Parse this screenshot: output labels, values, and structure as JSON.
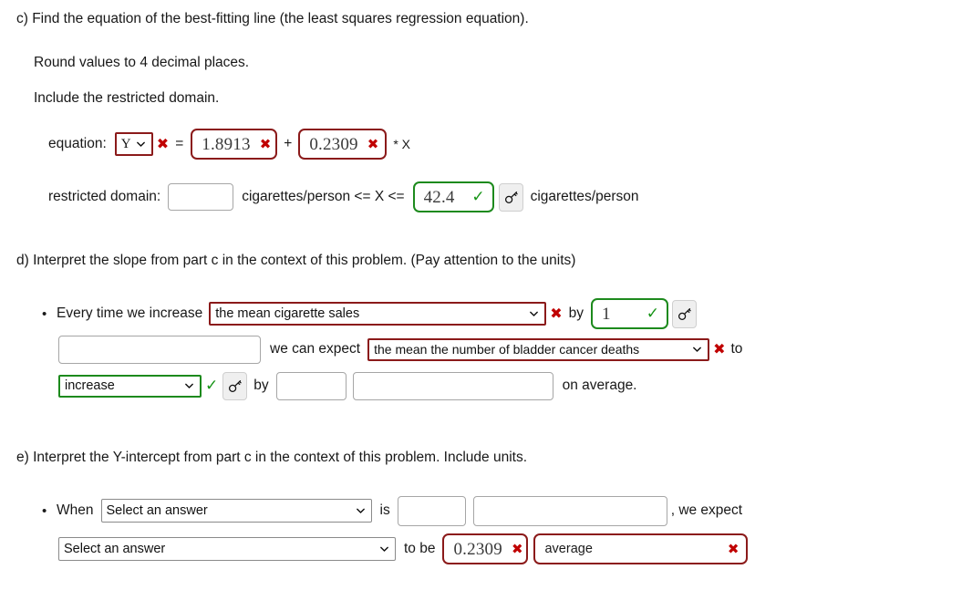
{
  "colors": {
    "incorrect": "#8b1a1a",
    "correct": "#1d8a1d",
    "x_mark": "#c00000",
    "check_mark": "#169416",
    "neutral_border": "#a6a6a6",
    "text": "#181818"
  },
  "part_c": {
    "prompt": "c) Find the equation of the best-fitting line (the least squares regression equation).",
    "instruction_round": "Round values to 4 decimal places.",
    "instruction_domain": "Include the restricted domain.",
    "equation": {
      "label": "equation:",
      "variable_select": {
        "value": "Y",
        "status": "incorrect"
      },
      "variable_status_icon": "x-mark",
      "equals": "=",
      "intercept": {
        "value": "1.8913",
        "status": "incorrect",
        "status_icon": "x-mark"
      },
      "plus": "+",
      "slope": {
        "value": "0.2309",
        "status": "incorrect",
        "status_icon": "x-mark"
      },
      "times_x": "* X"
    },
    "restricted_domain": {
      "label": "restricted domain:",
      "min_value": "",
      "min_placeholder": "",
      "middle_text": "cigarettes/person <= X <=",
      "max_value": "42.4",
      "max_status": "correct",
      "max_status_icon": "check-mark",
      "key_button": "key-icon",
      "units": "cigarettes/person"
    }
  },
  "part_d": {
    "prompt": "d) Interpret the slope from part c in the context of this problem. (Pay attention to the units)",
    "line1": {
      "lead": "Every time we increase",
      "subject_select": {
        "value": "the mean cigarette sales",
        "status": "incorrect"
      },
      "subject_status_icon": "x-mark",
      "by": "by",
      "amount": {
        "value": "1",
        "status": "correct",
        "status_icon": "check-mark"
      },
      "key_button": "key-icon"
    },
    "line2": {
      "units_input": "",
      "mid": "we can expect",
      "object_select": {
        "value": "the mean the number of bladder cancer deaths",
        "status": "incorrect"
      },
      "object_status_icon": "x-mark",
      "to": "to"
    },
    "line3": {
      "direction_select": {
        "value": "increase",
        "status": "correct"
      },
      "direction_status_icon": "check-mark",
      "key_button": "key-icon",
      "by": "by",
      "amount_input": "",
      "units_input": "",
      "tail": "on average."
    }
  },
  "part_e": {
    "prompt": "e) Interpret the Y-intercept from part c in the context of this problem. Include units.",
    "line1": {
      "when": "When",
      "subject_select": {
        "value": "Select an answer",
        "status": "neutral"
      },
      "is": "is",
      "value_input": "",
      "units_input": "",
      "tail": ", we expect"
    },
    "line2": {
      "object_select": {
        "value": "Select an answer",
        "status": "neutral"
      },
      "to_be": "to be",
      "value": {
        "value": "0.2309",
        "status": "incorrect",
        "status_icon": "x-mark"
      },
      "units": {
        "value": "average",
        "status": "incorrect",
        "status_icon": "x-mark"
      }
    }
  }
}
